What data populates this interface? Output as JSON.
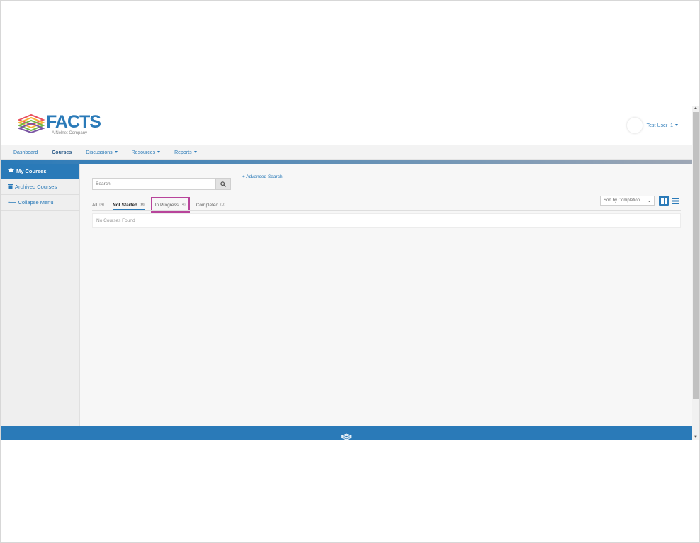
{
  "header": {
    "logo_text": "FACTS",
    "logo_sub": "A Nelnet Company",
    "user_name": "Test User_1"
  },
  "nav": {
    "items": [
      {
        "label": "Dashboard"
      },
      {
        "label": "Courses"
      },
      {
        "label": "Discussions"
      },
      {
        "label": "Resources"
      },
      {
        "label": "Reports"
      }
    ]
  },
  "sidebar": {
    "items": [
      {
        "label": "My Courses",
        "icon": "graduation-cap-icon"
      },
      {
        "label": "Archived Courses",
        "icon": "archive-icon"
      },
      {
        "label": "Collapse Menu",
        "icon": "arrow-left-icon"
      }
    ]
  },
  "main": {
    "search_placeholder": "Search",
    "advanced_search": "+ Advanced Search",
    "tabs": [
      {
        "label": "All",
        "count": "(4)"
      },
      {
        "label": "Not Started",
        "count": "(0)"
      },
      {
        "label": "In Progress",
        "count": "(4)"
      },
      {
        "label": "Completed",
        "count": "(0)"
      }
    ],
    "sort_label": "Sort by Completion",
    "no_courses": "No Courses Found"
  },
  "colors": {
    "accent": "#2a7ab8",
    "highlight": "#b8449b"
  }
}
